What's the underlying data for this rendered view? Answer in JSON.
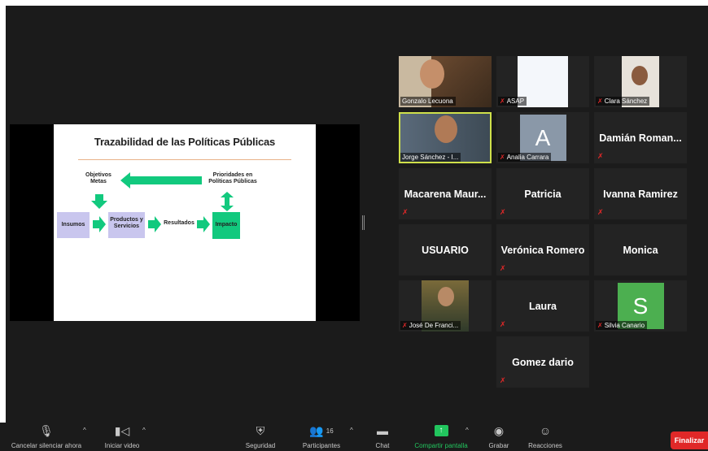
{
  "slide": {
    "title": "Trazabilidad de las Políticas Públicas",
    "objetivos": "Objetivos\nMetas",
    "prioridades": "Prioridades en\nPolíticas Públicas",
    "insumos": "Insumos",
    "productos": "Productos y\nServicios",
    "resultados": "Resultados",
    "impacto": "Impacto"
  },
  "gallery": [
    {
      "name": "Gonzalo Lecuona",
      "type": "video",
      "muted": false
    },
    {
      "name": "ASAP",
      "type": "logo",
      "muted": true
    },
    {
      "name": "Clara Sánchez",
      "type": "video",
      "muted": true
    },
    {
      "name": "Jorge Sánchez - I...",
      "type": "video",
      "muted": false,
      "active": true
    },
    {
      "name": "Analia Carrara",
      "type": "avatar",
      "avatar_letter": "A",
      "avatar_color": "#8a98a8",
      "muted": true
    },
    {
      "name": "Damián Roman...",
      "type": "name",
      "muted": true
    },
    {
      "name": "Macarena Maur...",
      "type": "name",
      "muted": true
    },
    {
      "name": "Patricia",
      "type": "name",
      "muted": true
    },
    {
      "name": "Ivanna Ramirez",
      "type": "name",
      "muted": true
    },
    {
      "name": "USUARIO",
      "type": "name",
      "muted": false
    },
    {
      "name": "Verónica Romero",
      "type": "name",
      "muted": true
    },
    {
      "name": "Monica",
      "type": "name",
      "muted": false
    },
    {
      "name": "José De Franci...",
      "type": "video",
      "muted": true
    },
    {
      "name": "Laura",
      "type": "name",
      "muted": true
    },
    {
      "name": "Silvia Canario",
      "type": "avatar",
      "avatar_letter": "S",
      "avatar_color": "#4caf50",
      "muted": true
    },
    {
      "name": "Gomez dario",
      "type": "name",
      "muted": true
    }
  ],
  "toolbar": {
    "unmute": "Cancelar silenciar ahora",
    "video": "Iniciar video",
    "security": "Seguridad",
    "participants": "Participantes",
    "participants_count": "16",
    "chat": "Chat",
    "share": "Compartir pantalla",
    "record": "Grabar",
    "reactions": "Reacciones",
    "end": "Finalizar"
  },
  "colors": {
    "accent_green": "#22c55e",
    "end_red": "#e02828",
    "active_speaker": "#cfe04a",
    "slide_green": "#12c97e",
    "slide_blue": "#c9c6ee"
  }
}
